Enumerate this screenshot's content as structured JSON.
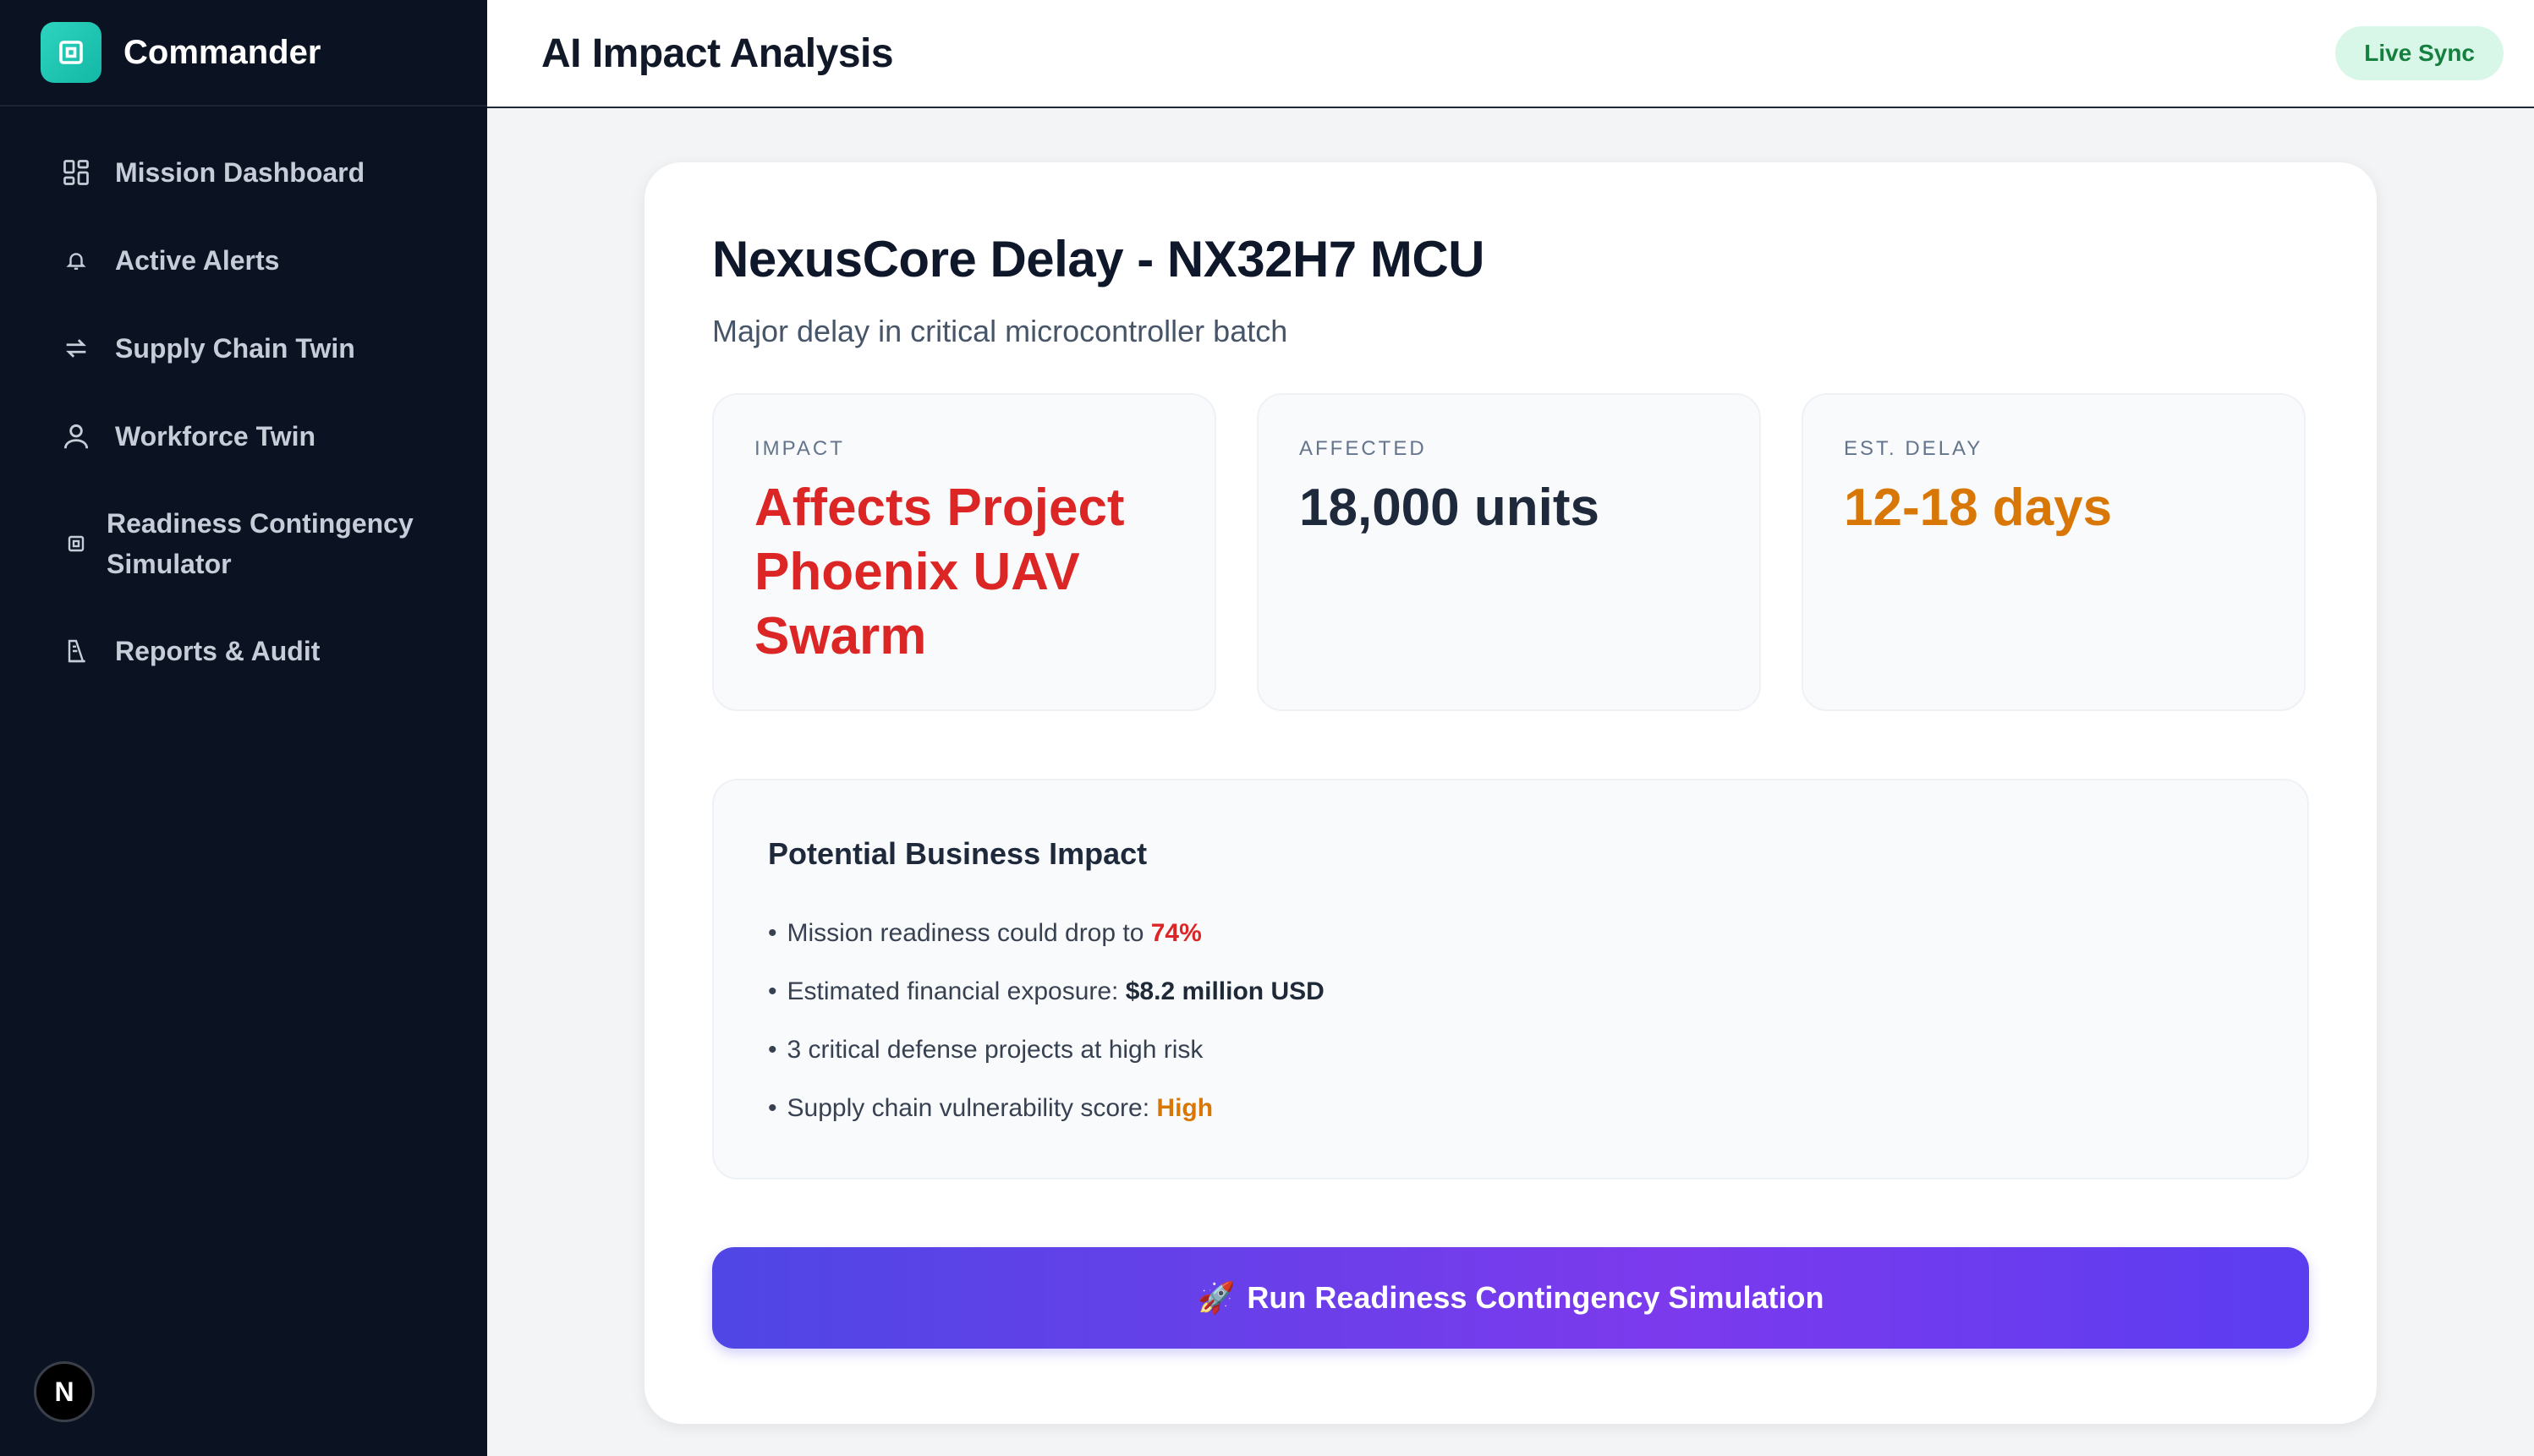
{
  "app": {
    "name": "Commander"
  },
  "sidebar": {
    "items": [
      {
        "label": "Mission Dashboard",
        "icon": "grid-icon"
      },
      {
        "label": "Active Alerts",
        "icon": "bell-icon"
      },
      {
        "label": "Supply Chain Twin",
        "icon": "arrows-icon"
      },
      {
        "label": "Workforce Twin",
        "icon": "user-icon"
      },
      {
        "label": "Readiness Contingency Simulator",
        "icon": "cpu-icon"
      },
      {
        "label": "Reports & Audit",
        "icon": "document-icon"
      }
    ],
    "badge": "N"
  },
  "header": {
    "title": "AI Impact Analysis",
    "status": "Live Sync"
  },
  "card": {
    "title": "NexusCore Delay - NX32H7 MCU",
    "subtitle": "Major delay in critical microcontroller batch",
    "stats": [
      {
        "label": "IMPACT",
        "value": "Affects Project Phoenix UAV Swarm",
        "color": "#dc2626"
      },
      {
        "label": "AFFECTED",
        "value": "18,000 units",
        "color": "#1e293b"
      },
      {
        "label": "EST. DELAY",
        "value": "12-18 days",
        "color": "#d97706"
      }
    ],
    "impact": {
      "title": "Potential Business Impact",
      "items": [
        {
          "prefix": "Mission readiness could drop to ",
          "value": "74%"
        },
        {
          "prefix": "Estimated financial exposure: ",
          "value": "$8.2 million USD"
        },
        {
          "prefix": "3 critical defense projects at high risk",
          "value": ""
        },
        {
          "prefix": "Supply chain vulnerability score: ",
          "value": "High"
        }
      ]
    },
    "button": {
      "icon": "🚀",
      "label": "Run Readiness Contingency Simulation"
    }
  },
  "colors": {
    "accent": "#4f46e5",
    "sidebar_bg": "#0b1323",
    "danger": "#dc2626",
    "warning": "#d97706",
    "success": "#15803d"
  }
}
